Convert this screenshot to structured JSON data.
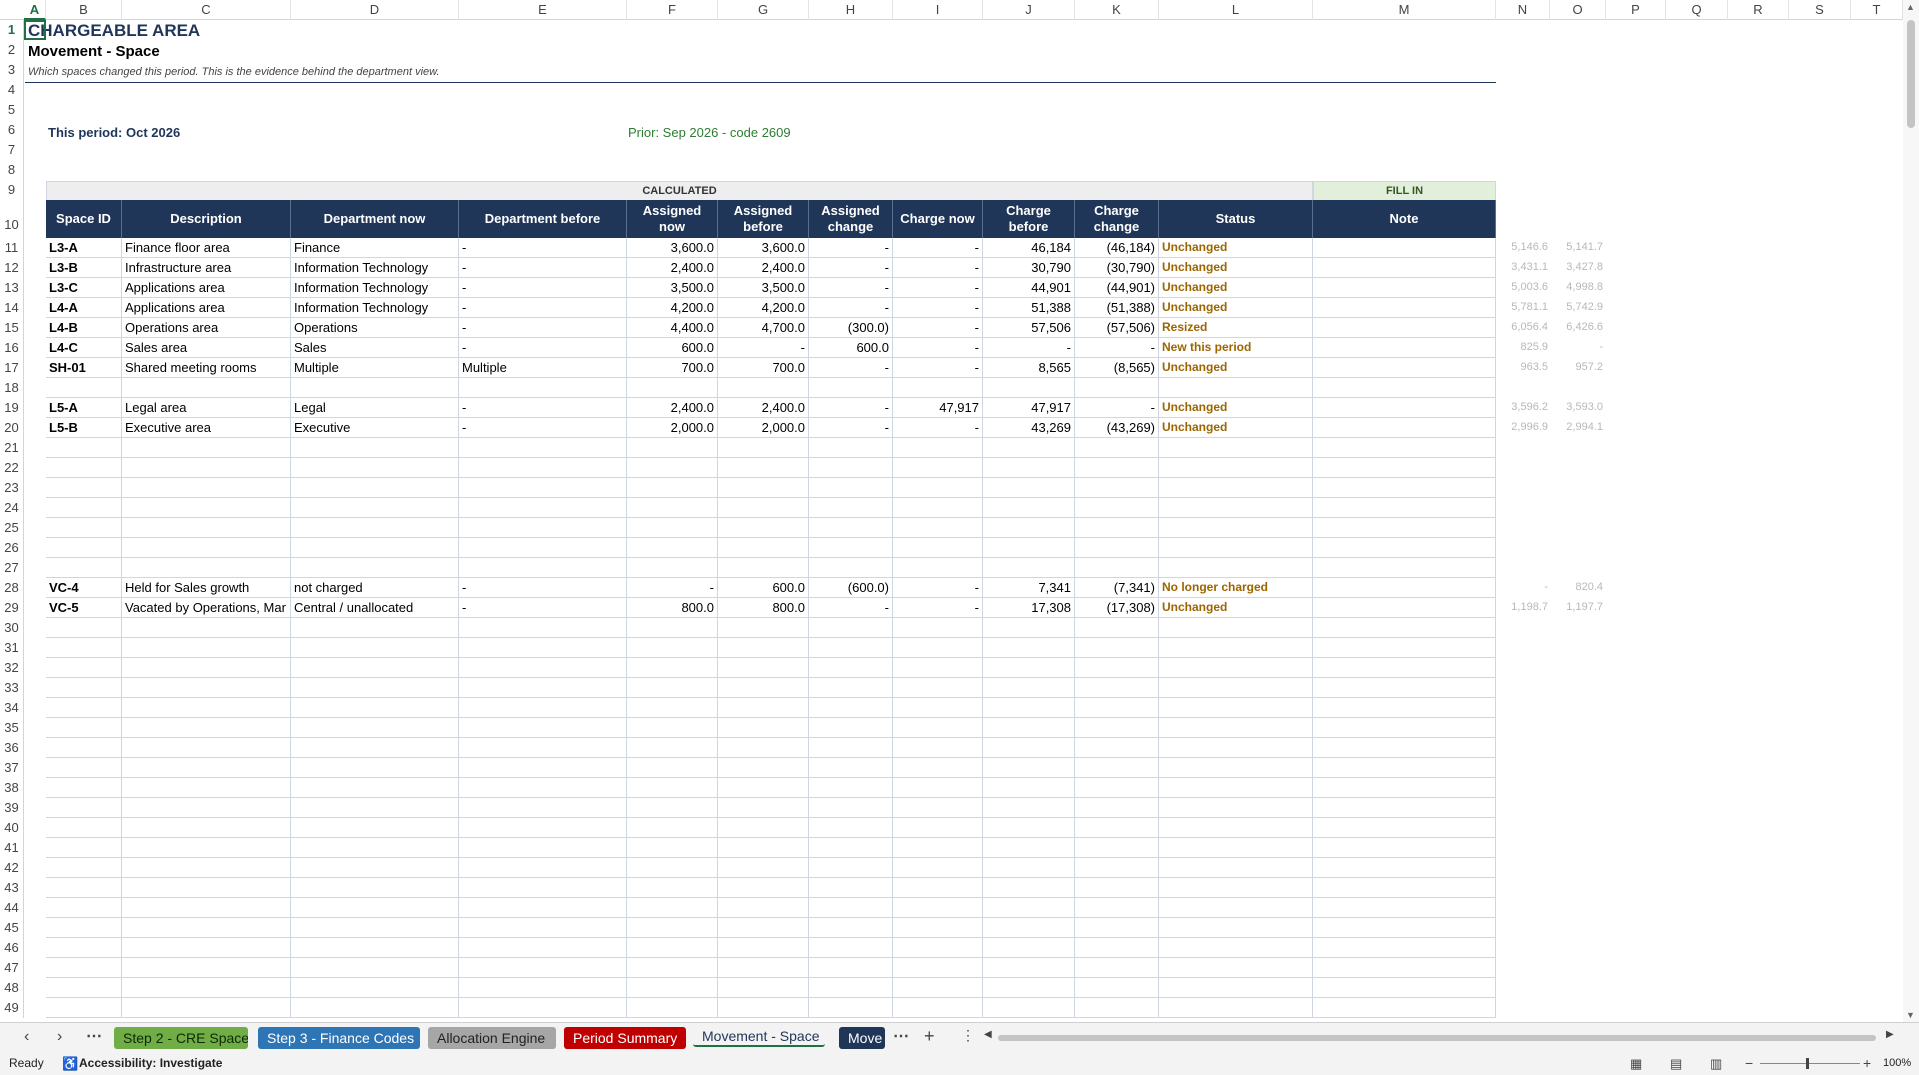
{
  "columns": [
    "A",
    "B",
    "C",
    "D",
    "E",
    "F",
    "G",
    "H",
    "I",
    "J",
    "K",
    "L",
    "M",
    "N",
    "O",
    "P",
    "Q",
    "R",
    "S",
    "T"
  ],
  "title": "CHARGEABLE AREA",
  "subtitle": "Movement - Space",
  "note": "Which spaces changed this period. This is the evidence behind the department view.",
  "this_period": "This period: Oct 2026",
  "prior_period": "Prior: Sep 2026 - code 2609",
  "band_calculated": "CALCULATED",
  "band_fill": "FILL IN",
  "headers": [
    "Space ID",
    "Description",
    "Department now",
    "Department before",
    "Assigned now",
    "Assigned before",
    "Assigned change",
    "Charge now",
    "Charge before",
    "Charge change",
    "Status",
    "Note"
  ],
  "rows": [
    {
      "r": 11,
      "id": "L3-A",
      "desc": "Finance floor area",
      "dnow": "Finance",
      "dbef": "-",
      "anow": "3,600.0",
      "abef": "3,600.0",
      "achg": "-",
      "cnow": "-",
      "cbef": "46,184",
      "cchg": "(46,184)",
      "status": "Unchanged",
      "n": "5,146.6",
      "o": "5,141.7"
    },
    {
      "r": 12,
      "id": "L3-B",
      "desc": "Infrastructure area",
      "dnow": "Information Technology",
      "dbef": "-",
      "anow": "2,400.0",
      "abef": "2,400.0",
      "achg": "-",
      "cnow": "-",
      "cbef": "30,790",
      "cchg": "(30,790)",
      "status": "Unchanged",
      "n": "3,431.1",
      "o": "3,427.8"
    },
    {
      "r": 13,
      "id": "L3-C",
      "desc": "Applications area",
      "dnow": "Information Technology",
      "dbef": "-",
      "anow": "3,500.0",
      "abef": "3,500.0",
      "achg": "-",
      "cnow": "-",
      "cbef": "44,901",
      "cchg": "(44,901)",
      "status": "Unchanged",
      "n": "5,003.6",
      "o": "4,998.8"
    },
    {
      "r": 14,
      "id": "L4-A",
      "desc": "Applications area",
      "dnow": "Information Technology",
      "dbef": "-",
      "anow": "4,200.0",
      "abef": "4,200.0",
      "achg": "-",
      "cnow": "-",
      "cbef": "51,388",
      "cchg": "(51,388)",
      "status": "Unchanged",
      "n": "5,781.1",
      "o": "5,742.9"
    },
    {
      "r": 15,
      "id": "L4-B",
      "desc": "Operations area",
      "dnow": "Operations",
      "dbef": "-",
      "anow": "4,400.0",
      "abef": "4,700.0",
      "achg": "(300.0)",
      "cnow": "-",
      "cbef": "57,506",
      "cchg": "(57,506)",
      "status": "Resized",
      "n": "6,056.4",
      "o": "6,426.6"
    },
    {
      "r": 16,
      "id": "L4-C",
      "desc": "Sales area",
      "dnow": "Sales",
      "dbef": "-",
      "anow": "600.0",
      "abef": "-",
      "achg": "600.0",
      "cnow": "-",
      "cbef": "-",
      "cchg": "-",
      "status": "New this period",
      "n": "825.9",
      "o": "-"
    },
    {
      "r": 17,
      "id": "SH-01",
      "desc": "Shared meeting rooms",
      "dnow": "Multiple",
      "dbef": "Multiple",
      "anow": "700.0",
      "abef": "700.0",
      "achg": "-",
      "cnow": "-",
      "cbef": "8,565",
      "cchg": "(8,565)",
      "status": "Unchanged",
      "n": "963.5",
      "o": "957.2"
    },
    {
      "r": 19,
      "id": "L5-A",
      "desc": "Legal area",
      "dnow": "Legal",
      "dbef": "-",
      "anow": "2,400.0",
      "abef": "2,400.0",
      "achg": "-",
      "cnow": "47,917",
      "cbef": "47,917",
      "cchg": "-",
      "status": "Unchanged",
      "n": "3,596.2",
      "o": "3,593.0"
    },
    {
      "r": 20,
      "id": "L5-B",
      "desc": "Executive area",
      "dnow": "Executive",
      "dbef": "-",
      "anow": "2,000.0",
      "abef": "2,000.0",
      "achg": "-",
      "cnow": "-",
      "cbef": "43,269",
      "cchg": "(43,269)",
      "status": "Unchanged",
      "n": "2,996.9",
      "o": "2,994.1"
    },
    {
      "r": 28,
      "id": "VC-4",
      "desc": "Held for Sales growth",
      "dnow": "not charged",
      "dbef": "-",
      "anow": "-",
      "abef": "600.0",
      "achg": "(600.0)",
      "cnow": "-",
      "cbef": "7,341",
      "cchg": "(7,341)",
      "status": "No longer charged",
      "n": "-",
      "o": "820.4"
    },
    {
      "r": 29,
      "id": "VC-5",
      "desc": "Vacated by Operations, Mar",
      "dnow": "Central / unallocated",
      "dbef": "-",
      "anow": "800.0",
      "abef": "800.0",
      "achg": "-",
      "cnow": "-",
      "cbef": "17,308",
      "cchg": "(17,308)",
      "status": "Unchanged",
      "n": "1,198.7",
      "o": "1,197.7"
    }
  ],
  "tabs": [
    {
      "label": "Step 2 - CRE Space",
      "bg": "#70ad47",
      "fg": "#0d2a00"
    },
    {
      "label": "Step 3 - Finance Codes",
      "bg": "#2e75b6",
      "fg": "#ffffff"
    },
    {
      "label": "Allocation Engine",
      "bg": "#a6a6a6",
      "fg": "#222222"
    },
    {
      "label": "Period Summary",
      "bg": "#c00000",
      "fg": "#ffffff"
    },
    {
      "label": "Movement - Space",
      "bg": "#f3f3f3",
      "fg": "#1f3659"
    },
    {
      "label": "Move",
      "bg": "#1f3659",
      "fg": "#ffffff"
    }
  ],
  "status": {
    "ready": "Ready",
    "accessibility": "Accessibility: Investigate",
    "zoom": "100%"
  },
  "icons": {
    "prev": "chevron-left-icon",
    "next": "chevron-right-icon",
    "more": "ellipsis-icon",
    "add": "plus-icon",
    "menu": "vertical-dots-icon"
  }
}
